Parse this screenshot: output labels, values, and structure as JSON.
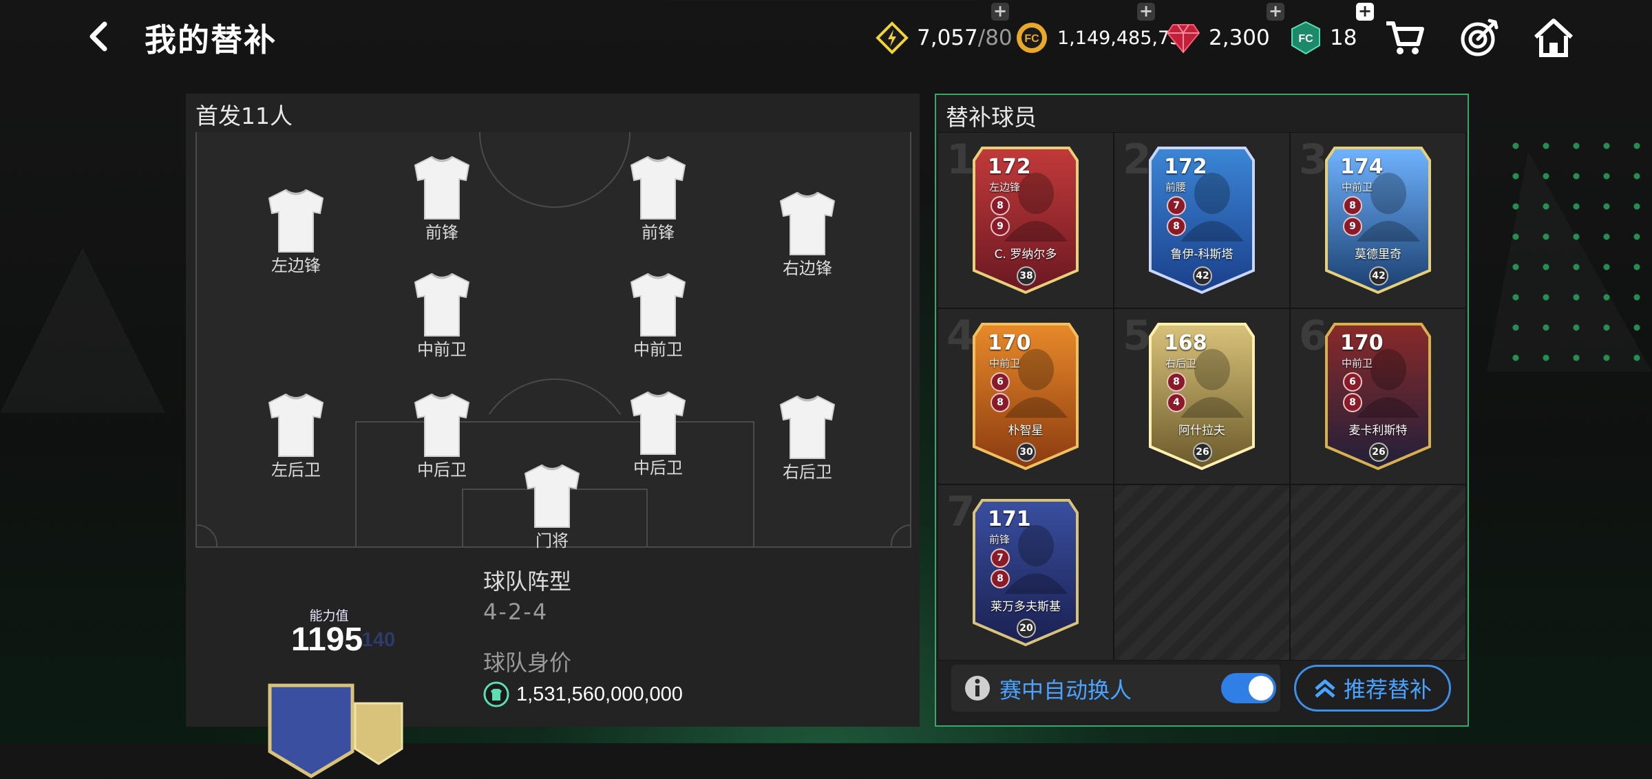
{
  "header": {
    "title": "我的替补",
    "currencies": [
      {
        "icon": "energy-icon",
        "value": "7,057",
        "max": "/80"
      },
      {
        "icon": "coin-icon",
        "value": "1,149,485,730"
      },
      {
        "icon": "gem-icon",
        "value": "2,300"
      },
      {
        "icon": "fc-point-icon",
        "value": "18"
      }
    ],
    "plus": "+",
    "nav_icons": [
      "cart-icon",
      "target-icon",
      "home-icon"
    ]
  },
  "starting": {
    "title": "首发11人",
    "positions": [
      {
        "label": "左边锋"
      },
      {
        "label": "前锋"
      },
      {
        "label": "前锋"
      },
      {
        "label": "右边锋"
      },
      {
        "label": "中前卫"
      },
      {
        "label": "中前卫"
      },
      {
        "label": "左后卫"
      },
      {
        "label": "中后卫"
      },
      {
        "label": "中后卫"
      },
      {
        "label": "右后卫"
      },
      {
        "label": "门将"
      }
    ],
    "badge": {
      "caption": "能力值",
      "rating": "1195",
      "sub": "140"
    },
    "formation_label": "球队阵型",
    "formation_value": "4-2-4",
    "value_label": "球队身价",
    "value_amount": "1,531,560,000,000"
  },
  "subs": {
    "title": "替补球员",
    "cards": [
      {
        "slot": "1",
        "ovr": "172",
        "role": "左边锋",
        "name": "C. 罗纳尔多",
        "chip1": "8",
        "chip2": "9",
        "bottom": "38",
        "theme": "portugal"
      },
      {
        "slot": "2",
        "ovr": "172",
        "role": "前腰",
        "name": "鲁伊-科斯塔",
        "chip1": "7",
        "chip2": "8",
        "bottom": "42",
        "theme": "blue"
      },
      {
        "slot": "3",
        "ovr": "174",
        "role": "中前卫",
        "name": "莫德里奇",
        "chip1": "8",
        "chip2": "9",
        "bottom": "42",
        "theme": "ice"
      },
      {
        "slot": "4",
        "ovr": "170",
        "role": "中前卫",
        "name": "朴智星",
        "chip1": "6",
        "chip2": "8",
        "bottom": "30",
        "theme": "orange"
      },
      {
        "slot": "5",
        "ovr": "168",
        "role": "右后卫",
        "name": "阿什拉夫",
        "chip1": "8",
        "chip2": "4",
        "bottom": "26",
        "theme": "gold"
      },
      {
        "slot": "6",
        "ovr": "170",
        "role": "中前卫",
        "name": "麦卡利斯特",
        "chip1": "6",
        "chip2": "8",
        "bottom": "26",
        "theme": "darkgold"
      },
      {
        "slot": "7",
        "ovr": "171",
        "role": "前锋",
        "name": "莱万多夫斯基",
        "chip1": "7",
        "chip2": "8",
        "bottom": "20",
        "theme": "navy"
      }
    ],
    "auto_sub_label": "赛中自动换人",
    "auto_sub_on": true,
    "recommend_label": "推荐替补"
  }
}
